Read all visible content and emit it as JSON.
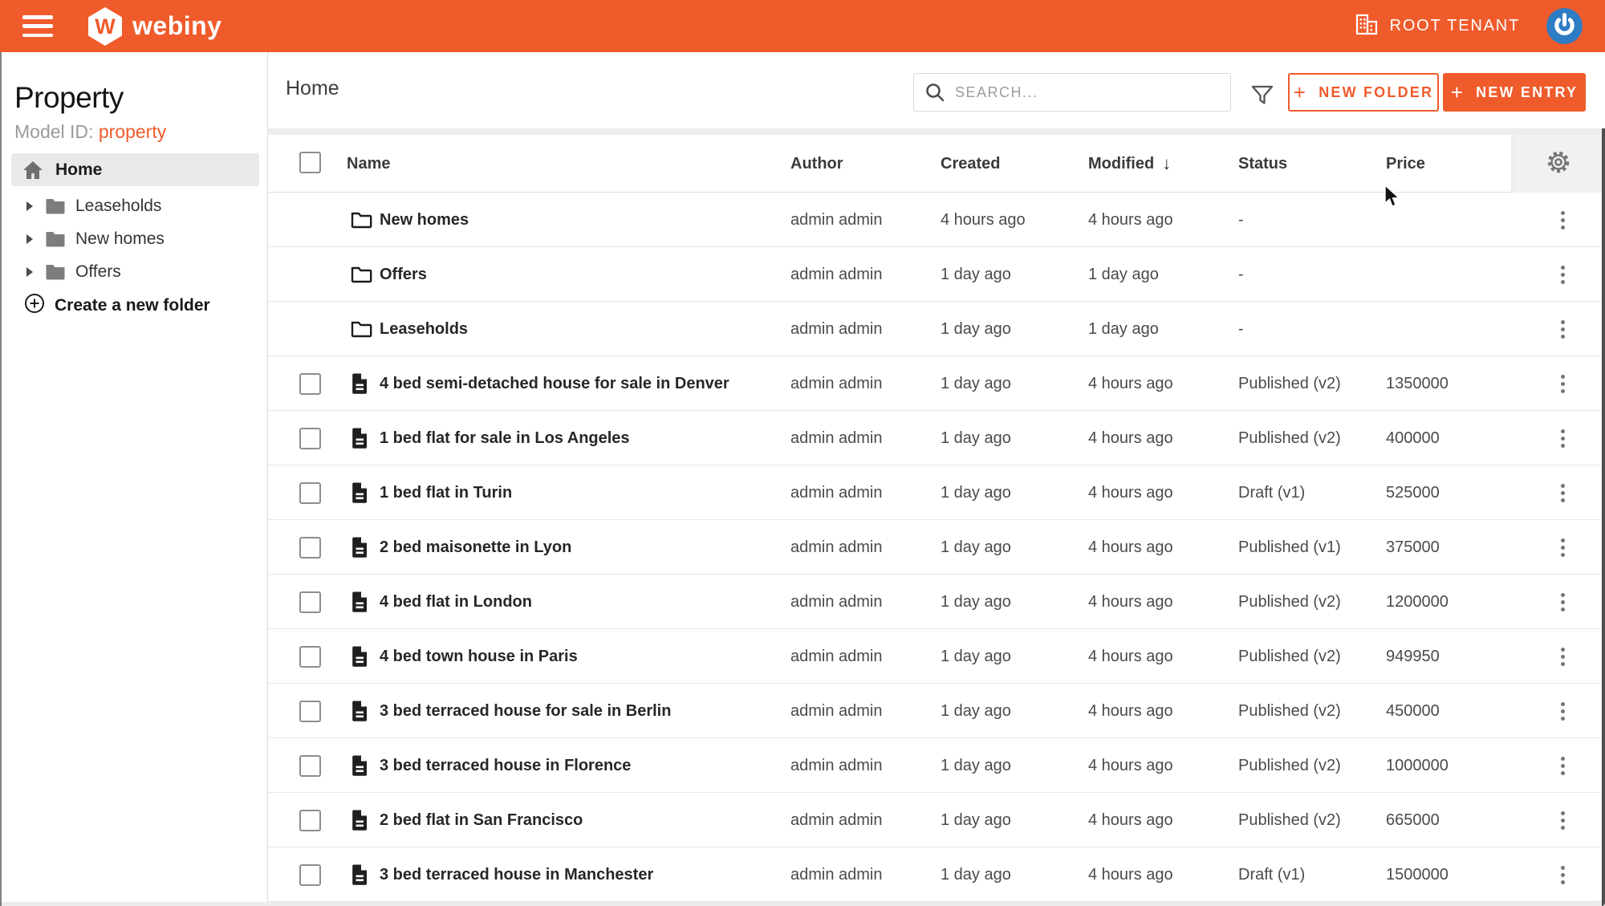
{
  "appbar": {
    "brand": "webiny",
    "brand_initial": "W",
    "tenant_label": "ROOT TENANT"
  },
  "sidebar": {
    "title": "Property",
    "model_id_label": "Model ID:",
    "model_id_value": "property",
    "home_label": "Home",
    "folders": [
      "Leaseholds",
      "New homes",
      "Offers"
    ],
    "create_folder_label": "Create a new folder"
  },
  "toolbar": {
    "title": "Home",
    "search_placeholder": "SEARCH...",
    "plus_icon": "+",
    "new_folder_label": "NEW FOLDER",
    "new_entry_label": "NEW ENTRY"
  },
  "table": {
    "columns": [
      "Name",
      "Author",
      "Created",
      "Modified",
      "Status",
      "Price"
    ],
    "sort_icon": "↓",
    "sorted_column": "Modified",
    "rows": [
      {
        "type": "folder",
        "name": "New homes",
        "author": "admin admin",
        "created": "4 hours ago",
        "modified": "4 hours ago",
        "status": "-",
        "price": ""
      },
      {
        "type": "folder",
        "name": "Offers",
        "author": "admin admin",
        "created": "1 day ago",
        "modified": "1 day ago",
        "status": "-",
        "price": ""
      },
      {
        "type": "folder",
        "name": "Leaseholds",
        "author": "admin admin",
        "created": "1 day ago",
        "modified": "1 day ago",
        "status": "-",
        "price": ""
      },
      {
        "type": "entry",
        "name": "4 bed semi-detached house for sale in Denver",
        "author": "admin admin",
        "created": "1 day ago",
        "modified": "4 hours ago",
        "status": "Published (v2)",
        "price": "1350000"
      },
      {
        "type": "entry",
        "name": "1 bed flat for sale in Los Angeles",
        "author": "admin admin",
        "created": "1 day ago",
        "modified": "4 hours ago",
        "status": "Published (v2)",
        "price": "400000"
      },
      {
        "type": "entry",
        "name": "1 bed flat in Turin",
        "author": "admin admin",
        "created": "1 day ago",
        "modified": "4 hours ago",
        "status": "Draft (v1)",
        "price": "525000"
      },
      {
        "type": "entry",
        "name": "2 bed maisonette in Lyon",
        "author": "admin admin",
        "created": "1 day ago",
        "modified": "4 hours ago",
        "status": "Published (v1)",
        "price": "375000"
      },
      {
        "type": "entry",
        "name": "4 bed flat in London",
        "author": "admin admin",
        "created": "1 day ago",
        "modified": "4 hours ago",
        "status": "Published (v2)",
        "price": "1200000"
      },
      {
        "type": "entry",
        "name": "4 bed town house in Paris",
        "author": "admin admin",
        "created": "1 day ago",
        "modified": "4 hours ago",
        "status": "Published (v2)",
        "price": "949950"
      },
      {
        "type": "entry",
        "name": "3 bed terraced house for sale in Berlin",
        "author": "admin admin",
        "created": "1 day ago",
        "modified": "4 hours ago",
        "status": "Published (v2)",
        "price": "450000"
      },
      {
        "type": "entry",
        "name": "3 bed terraced house in Florence",
        "author": "admin admin",
        "created": "1 day ago",
        "modified": "4 hours ago",
        "status": "Published (v2)",
        "price": "1000000"
      },
      {
        "type": "entry",
        "name": "2 bed flat in San Francisco",
        "author": "admin admin",
        "created": "1 day ago",
        "modified": "4 hours ago",
        "status": "Published (v2)",
        "price": "665000"
      },
      {
        "type": "entry",
        "name": "3 bed terraced house in Manchester",
        "author": "admin admin",
        "created": "1 day ago",
        "modified": "4 hours ago",
        "status": "Draft (v1)",
        "price": "1500000"
      }
    ]
  },
  "colors": {
    "accent": "#F05B2B",
    "appbar_bg": "#F05B2B",
    "selected_nav_bg": "#e9e9e9",
    "avatar_blue": "#2e7cc4",
    "icon_gray": "#757575"
  }
}
